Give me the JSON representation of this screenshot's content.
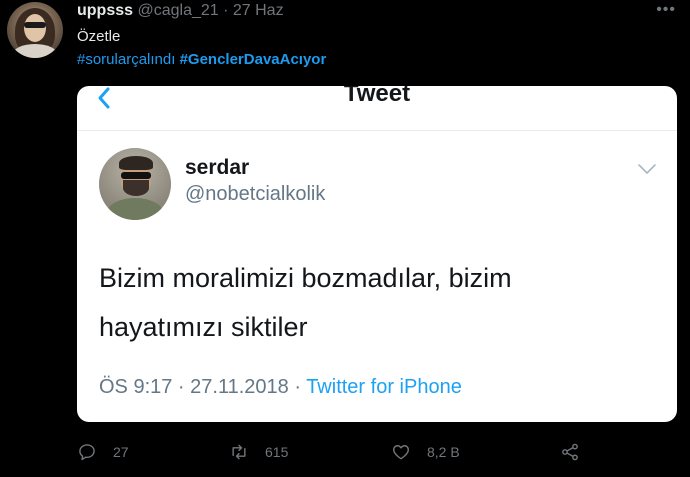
{
  "tweet": {
    "author_name": "uppsss",
    "author_meta": "@cagla_21 · 27 Haz",
    "text": "Özetle",
    "hashtag_1": "#sorularçalındı",
    "hashtag_2": "#GenclerDavaAcıyor"
  },
  "embedded": {
    "title": "Tweet",
    "name": "serdar",
    "handle": "@nobetcialkolik",
    "text_line_1": "Bizim moralimizi bozmadılar, bizim",
    "text_line_2": "hayatımızı siktiler",
    "footer_time": "ÖS 9:17 · 27.11.2018 · ",
    "footer_source": "Twitter for iPhone"
  },
  "actions": {
    "replies": "27",
    "retweets": "615",
    "likes": "8,2 B"
  },
  "icons": {
    "more": "more-horizontal-icon",
    "reply": "reply-icon",
    "retweet": "retweet-icon",
    "like": "heart-icon",
    "share": "share-icon",
    "back": "chevron-left-icon",
    "caret": "chevron-down-icon"
  },
  "colors": {
    "background": "#000000",
    "link": "#1d9bf0",
    "muted": "#71767b",
    "embedded_link": "#1da1f2"
  }
}
